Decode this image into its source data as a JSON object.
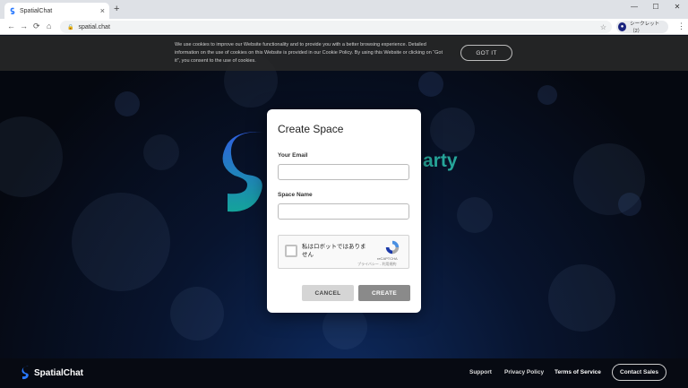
{
  "browser": {
    "tab_title": "SpatialChat",
    "tab_close": "×",
    "new_tab": "+",
    "url": "spatial.chat",
    "profile_label": "シークレット（2）",
    "window_controls": [
      "—",
      "☐",
      "✕"
    ],
    "nav_icons": [
      "back-icon",
      "forward-icon",
      "reload-icon",
      "home-icon"
    ]
  },
  "cookie_banner": {
    "text": "We use cookies to improve our Website functionality and to provide you with a better browsing experience. Detailed information on the use of cookies on this Website is provided in our Cookie Policy. By using this Website or clicking on “Got it”, you consent to the use of cookies.",
    "button": "GOT IT"
  },
  "background": {
    "partial_text": "arty",
    "brand_colors": {
      "teal": "#26a69a",
      "blue": "#1e5bd8"
    }
  },
  "modal": {
    "title": "Create Space",
    "email_label": "Your Email",
    "email_value": "",
    "space_label": "Space Name",
    "space_value": "",
    "captcha": {
      "text": "私はロボットではありません",
      "brand": "reCAPTCHA",
      "links": "プライバシー - 利用規約"
    },
    "cancel": "CANCEL",
    "create": "CREATE"
  },
  "footer": {
    "logo_text": "SpatialChat",
    "links": [
      "Support",
      "Privacy Policy",
      "Terms of Service"
    ],
    "contact": "Contact Sales"
  }
}
